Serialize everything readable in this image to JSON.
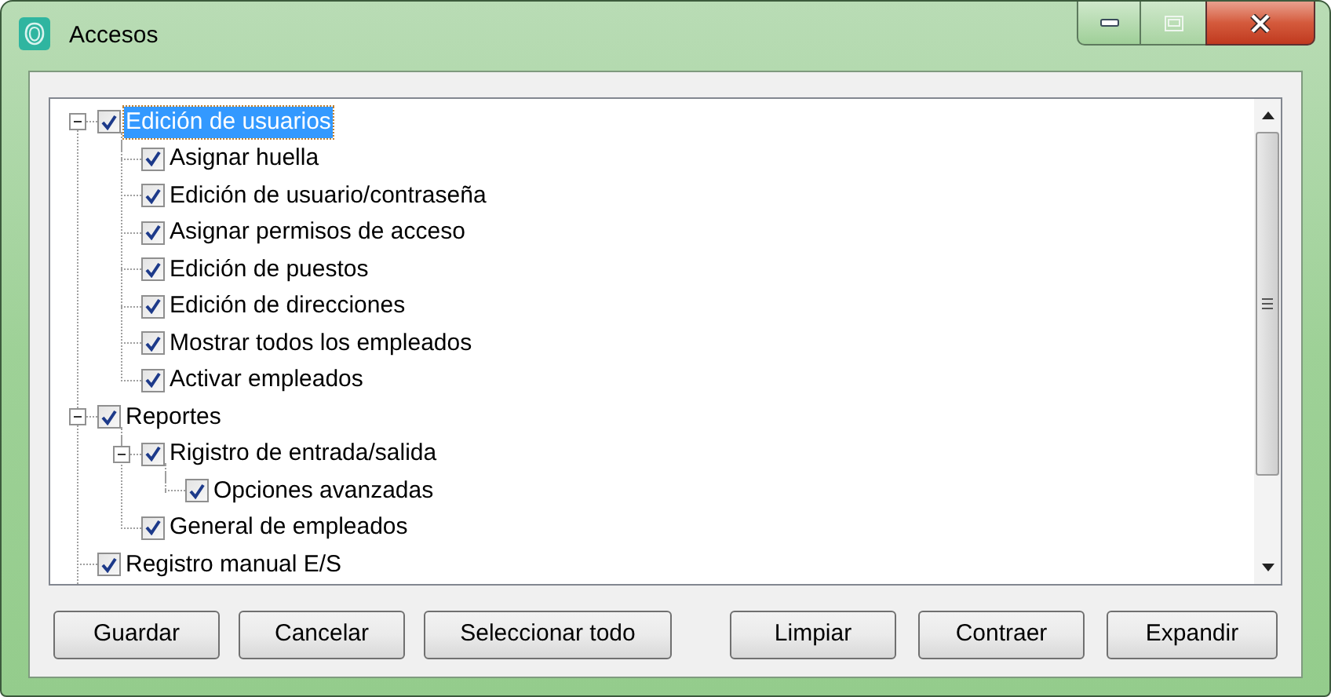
{
  "window": {
    "title": "Accesos"
  },
  "tree": [
    {
      "label": "Edición de usuarios",
      "checked": true,
      "selected": true,
      "expanded": true,
      "children": [
        {
          "label": "Asignar huella",
          "checked": true,
          "selected": false
        },
        {
          "label": "Edición de usuario/contraseña",
          "checked": true,
          "selected": false
        },
        {
          "label": "Asignar permisos de acceso",
          "checked": true,
          "selected": false
        },
        {
          "label": "Edición de puestos",
          "checked": true,
          "selected": false
        },
        {
          "label": "Edición de direcciones",
          "checked": true,
          "selected": false
        },
        {
          "label": "Mostrar todos los empleados",
          "checked": true,
          "selected": false
        },
        {
          "label": "Activar empleados",
          "checked": true,
          "selected": false
        }
      ]
    },
    {
      "label": "Reportes",
      "checked": true,
      "selected": false,
      "expanded": true,
      "children": [
        {
          "label": "Rigistro de entrada/salida",
          "checked": true,
          "selected": false,
          "expanded": true,
          "children": [
            {
              "label": "Opciones avanzadas",
              "checked": true,
              "selected": false
            }
          ]
        },
        {
          "label": "General de empleados",
          "checked": true,
          "selected": false
        }
      ]
    },
    {
      "label": "Registro manual E/S",
      "checked": true,
      "selected": false
    }
  ],
  "buttons_left": [
    "Guardar",
    "Cancelar",
    "Seleccionar todo"
  ],
  "buttons_right": [
    "Limpiar",
    "Contraer",
    "Expandir"
  ]
}
